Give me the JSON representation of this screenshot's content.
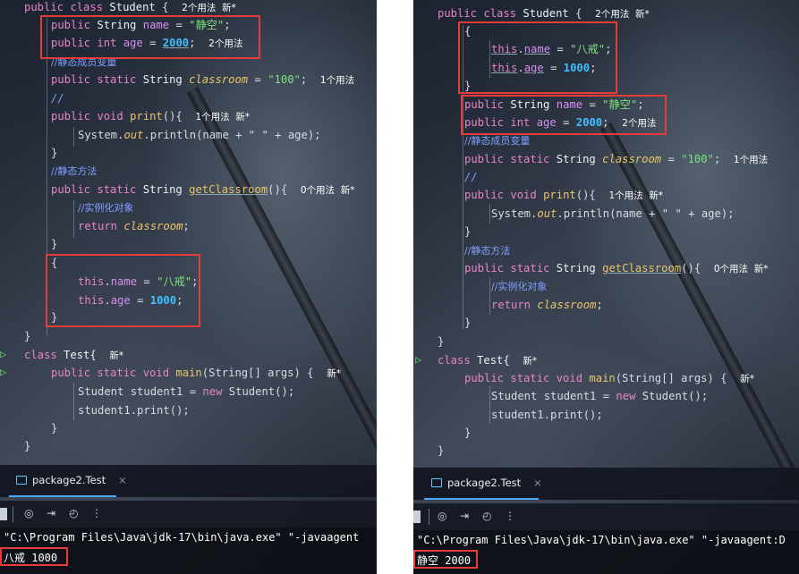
{
  "left": {
    "lines": {
      "class_decl": {
        "kw": "public class",
        "name": "Student",
        "brace": "{",
        "hint": "2个用法  新*"
      },
      "field_name": {
        "mod": "public",
        "type": "String",
        "field": "name",
        "eq": "=",
        "val": "\"静空\"",
        "semi": ";"
      },
      "field_age": {
        "mod": "public int",
        "field": "age",
        "eq": "=",
        "val": "2000",
        "semi": ";",
        "hint": "2个用法"
      },
      "cmt_static_var": "//静态成员变量",
      "field_classroom": {
        "mod": "public static",
        "type": "String",
        "field": "classroom",
        "eq": "=",
        "val": "\"100\"",
        "semi": ";",
        "hint": "1个用法"
      },
      "cmt_empty": "//",
      "print_decl": {
        "mod": "public void",
        "fn": "print",
        "rest": "(){",
        "hint": "1个用法  新*"
      },
      "print_body": {
        "obj": "System.",
        "out": "out",
        "rest": ".println(name + \" \" + age);"
      },
      "close1": "}",
      "cmt_static_method": "//静态方法",
      "getcls_decl": {
        "mod": "public static",
        "type": "String",
        "fn": "getClassroom",
        "rest": "(){",
        "hint": "0个用法  新*"
      },
      "cmt_instance": "//实例化对象",
      "return_line": {
        "kw": "return",
        "val": "classroom",
        "semi": ";"
      },
      "close2": "}",
      "block_open": "{",
      "this_name": {
        "kw": "this",
        "field": "name",
        "eq": "=",
        "val": "\"八戒\"",
        "semi": ";"
      },
      "this_age": {
        "kw": "this",
        "field": "age",
        "eq": "=",
        "val": "1000",
        "semi": ";"
      },
      "block_close": "}",
      "class_close": "}",
      "test_decl": {
        "kw": "class",
        "name": "Test{",
        "hint": "新*"
      },
      "main_decl": {
        "mod": "public static void",
        "fn": "main",
        "rest": "(String[] args) {",
        "hint": "新*"
      },
      "new_line": {
        "text": "Student student1 = ",
        "kw": "new",
        "rest": "Student();"
      },
      "call_line": "student1.print();",
      "close3": "}",
      "close4": "}"
    },
    "tab_label": "package2.Test",
    "tab_close": "×",
    "cmd": "\"C:\\Program Files\\Java\\jdk-17\\bin\\java.exe\" \"-javaagent",
    "output": "八戒 1000"
  },
  "right": {
    "lines": {
      "class_decl": {
        "kw": "public class",
        "name": "Student",
        "brace": "{",
        "hint": "2个用法  新*"
      },
      "block_open": "{",
      "this_name": {
        "kw": "this",
        "field": "name",
        "eq": "=",
        "val": "\"八戒\"",
        "semi": ";"
      },
      "this_age": {
        "kw": "this",
        "field": "age",
        "eq": "=",
        "val": "1000",
        "semi": ";"
      },
      "block_close": "}",
      "field_name": {
        "mod": "public",
        "type": "String",
        "field": "name",
        "eq": "=",
        "val": "\"静空\"",
        "semi": ";"
      },
      "field_age": {
        "mod": "public int",
        "field": "age",
        "eq": "=",
        "val": "2000",
        "semi": ";",
        "hint": "2个用法"
      },
      "cmt_static_var": "//静态成员变量",
      "field_classroom": {
        "mod": "public static",
        "type": "String",
        "field": "classroom",
        "eq": "=",
        "val": "\"100\"",
        "semi": ";",
        "hint": "1个用法"
      },
      "cmt_empty": "//",
      "print_decl": {
        "mod": "public void",
        "fn": "print",
        "rest": "(){",
        "hint": "1个用法  新*"
      },
      "print_body": {
        "obj": "System.",
        "out": "out",
        "rest": ".println(name + \" \" + age);"
      },
      "close1": "}",
      "cmt_static_method": "//静态方法",
      "getcls_decl": {
        "mod": "public static",
        "type": "String",
        "fn": "getClassroom",
        "rest": "(){",
        "hint": "0个用法  新*"
      },
      "cmt_instance": "//实例化对象",
      "return_line": {
        "kw": "return",
        "val": "classroom",
        "semi": ";"
      },
      "close2": "}",
      "class_close": "}",
      "test_decl": {
        "kw": "class",
        "name": "Test{",
        "hint": "新*"
      },
      "main_decl": {
        "mod": "public static void",
        "fn": "main",
        "rest": "(String[] args) {",
        "hint": "新*"
      },
      "new_line": {
        "text": "Student student1 = ",
        "kw": "new",
        "rest": "Student();"
      },
      "call_line": "student1.print();",
      "close3": "}",
      "close4": "}"
    },
    "tab_label": "package2.Test",
    "tab_close": "×",
    "cmd": "\"C:\\Program Files\\Java\\jdk-17\\bin\\java.exe\" \"-javaagent:D",
    "output": "静空 2000"
  },
  "icons": {
    "run": "▷",
    "camera": "◎",
    "exit": "⇥",
    "inspect": "◴",
    "more": "⋮"
  },
  "colors": {
    "highlight_box": "#e53b3b",
    "keyword": "#e684c9",
    "number": "#3fc0ff",
    "string": "#7fe07f",
    "comment": "#7fa0ff"
  }
}
